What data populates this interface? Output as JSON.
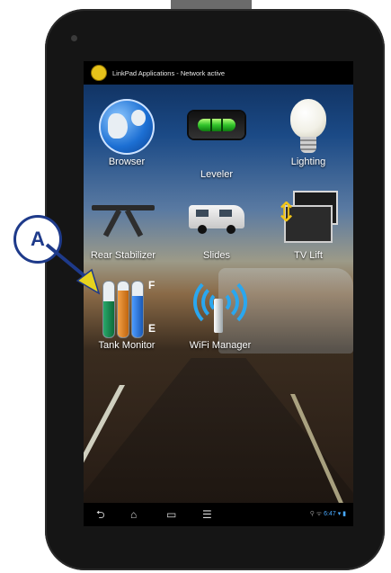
{
  "status_bar": {
    "title": "LinkPad Applications - Network active"
  },
  "apps": [
    {
      "label": "Browser",
      "icon": "globe-icon"
    },
    {
      "label": "Leveler",
      "icon": "level-vial-icon"
    },
    {
      "label": "Lighting",
      "icon": "light-bulb-icon"
    },
    {
      "label": "Rear Stabilizer",
      "icon": "stabilizer-icon"
    },
    {
      "label": "Slides",
      "icon": "rv-slides-icon"
    },
    {
      "label": "TV Lift",
      "icon": "tv-lift-icon"
    },
    {
      "label": "Tank Monitor",
      "icon": "tank-gauge-icon"
    },
    {
      "label": "WiFi Manager",
      "icon": "wifi-antenna-icon"
    }
  ],
  "tank_markers": {
    "full": "F",
    "empty": "E"
  },
  "callout": {
    "letter": "A"
  },
  "nav_bar": {
    "icons": [
      "back-icon",
      "home-icon",
      "recent-apps-icon",
      "menu-icon"
    ],
    "tray_time": "6:47"
  },
  "colors": {
    "callout_border": "#1e3a8a",
    "callout_arrow": "#e6d21e",
    "tank_green": "#2aa86a",
    "tank_orange": "#f2a046",
    "tank_blue": "#4d9bff",
    "wifi_blue": "#2aa7ef"
  }
}
